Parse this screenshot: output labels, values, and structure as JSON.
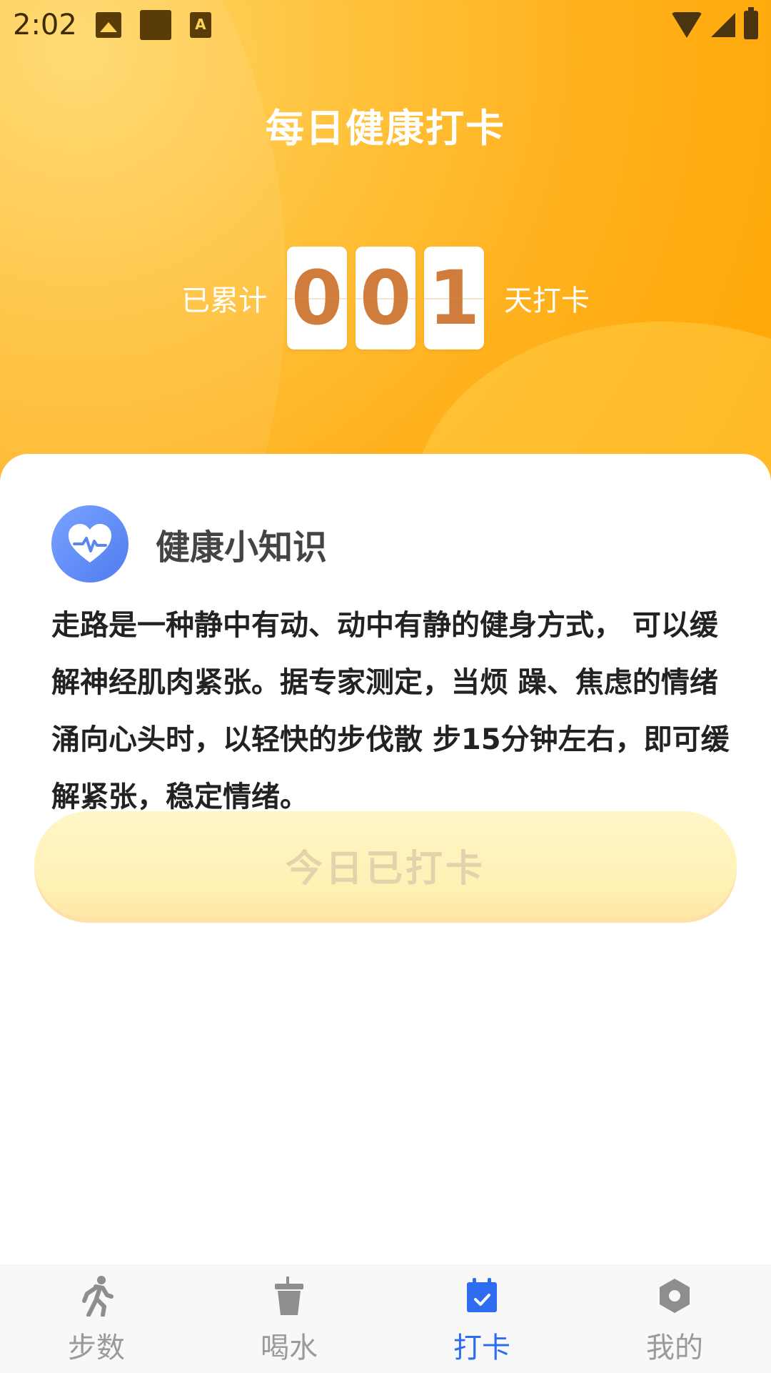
{
  "status_bar": {
    "time": "2:02"
  },
  "header": {
    "title": "每日健康打卡",
    "counter_prefix": "已累计",
    "counter_digits": [
      "0",
      "0",
      "1"
    ],
    "counter_suffix": "天打卡"
  },
  "tip": {
    "title": "健康小知识",
    "body": "走路是一种静中有动、动中有静的健身方式， 可以缓解神经肌肉紧张。据专家测定，当烦 躁、焦虑的情绪涌向心头时，以轻快的步伐散 步15分钟左右，即可缓解紧张，稳定情绪。"
  },
  "checkin_button": {
    "label": "今日已打卡"
  },
  "tabs": [
    {
      "label": "步数",
      "icon": "walk-icon"
    },
    {
      "label": "喝水",
      "icon": "cup-icon"
    },
    {
      "label": "打卡",
      "icon": "calendar-check-icon",
      "active": true
    },
    {
      "label": "我的",
      "icon": "hexagon-settings-icon"
    }
  ],
  "colors": {
    "accent": "#2f6df0",
    "header": "#ffb21f",
    "digit": "#d07c3c"
  }
}
